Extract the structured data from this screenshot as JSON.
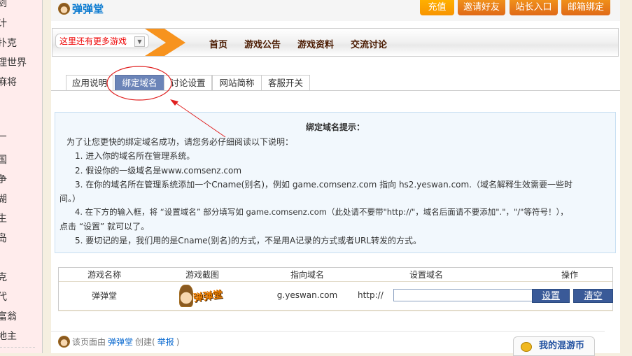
{
  "sidebar": {
    "items": [
      "剑",
      "计",
      "扑克",
      "理世界",
      "麻将",
      "厂",
      "国",
      "争",
      "湖",
      "生",
      "岛",
      "克",
      "代",
      "富翁",
      "地主"
    ]
  },
  "header": {
    "site_name": "弹弹堂",
    "buttons": [
      "充值",
      "邀请好友",
      "站长入口",
      "邮箱绑定"
    ]
  },
  "nav": {
    "game_select": "这里还有更多游戏",
    "links": [
      "首页",
      "游戏公告",
      "游戏资料",
      "交流讨论"
    ]
  },
  "tabs": [
    {
      "label": "应用说明"
    },
    {
      "label": "绑定域名",
      "active": true
    },
    {
      "label": "讨论设置"
    },
    {
      "label": "网站简称"
    },
    {
      "label": "客服开关"
    }
  ],
  "tips": {
    "title": "绑定域名提示：",
    "lines": [
      "为了让您更快的绑定域名成功，请您务必仔细阅读以下说明：",
      "1. 进入你的域名所在管理系统。",
      "2. 假设你的一级域名是www.comsenz.com",
      "3. 在你的域名所在管理系统添加一个Cname(别名)，例如  game.comsenz.com 指向  hs2.yeswan.com.（域名解释生效需要一些时",
      "间。）",
      "4. 在下方的输入框，将 “设置域名” 部分填写如  game.comsenz.com（此处请不要带\"http://\"，域名后面请不要添加\".\"，\"/\"等符号！），",
      "点击 “设置” 就可以了。",
      "5. 要切记的是，我们用的是Cname(别名)的方式，不是用A记录的方式或者URL转发的方式。"
    ]
  },
  "table": {
    "headers": [
      "游戏名称",
      "游戏截图",
      "指向域名",
      "设置域名",
      "操作"
    ],
    "row": {
      "name": "弹弹堂",
      "screenshot_text": "弹弹堂",
      "target": "g.yeswan.com",
      "prefix": "http://",
      "domain_value": "",
      "set": "设置",
      "clear": "清空"
    }
  },
  "footer": {
    "pre": "该页面由",
    "creator": "弹弹堂",
    "mid": "创建(",
    "report": "举报",
    "post": ")",
    "coins": "我的混游币"
  },
  "colors": {
    "accent": "#6b84b8",
    "button": "#e06a18",
    "annotation": "#e02020"
  }
}
